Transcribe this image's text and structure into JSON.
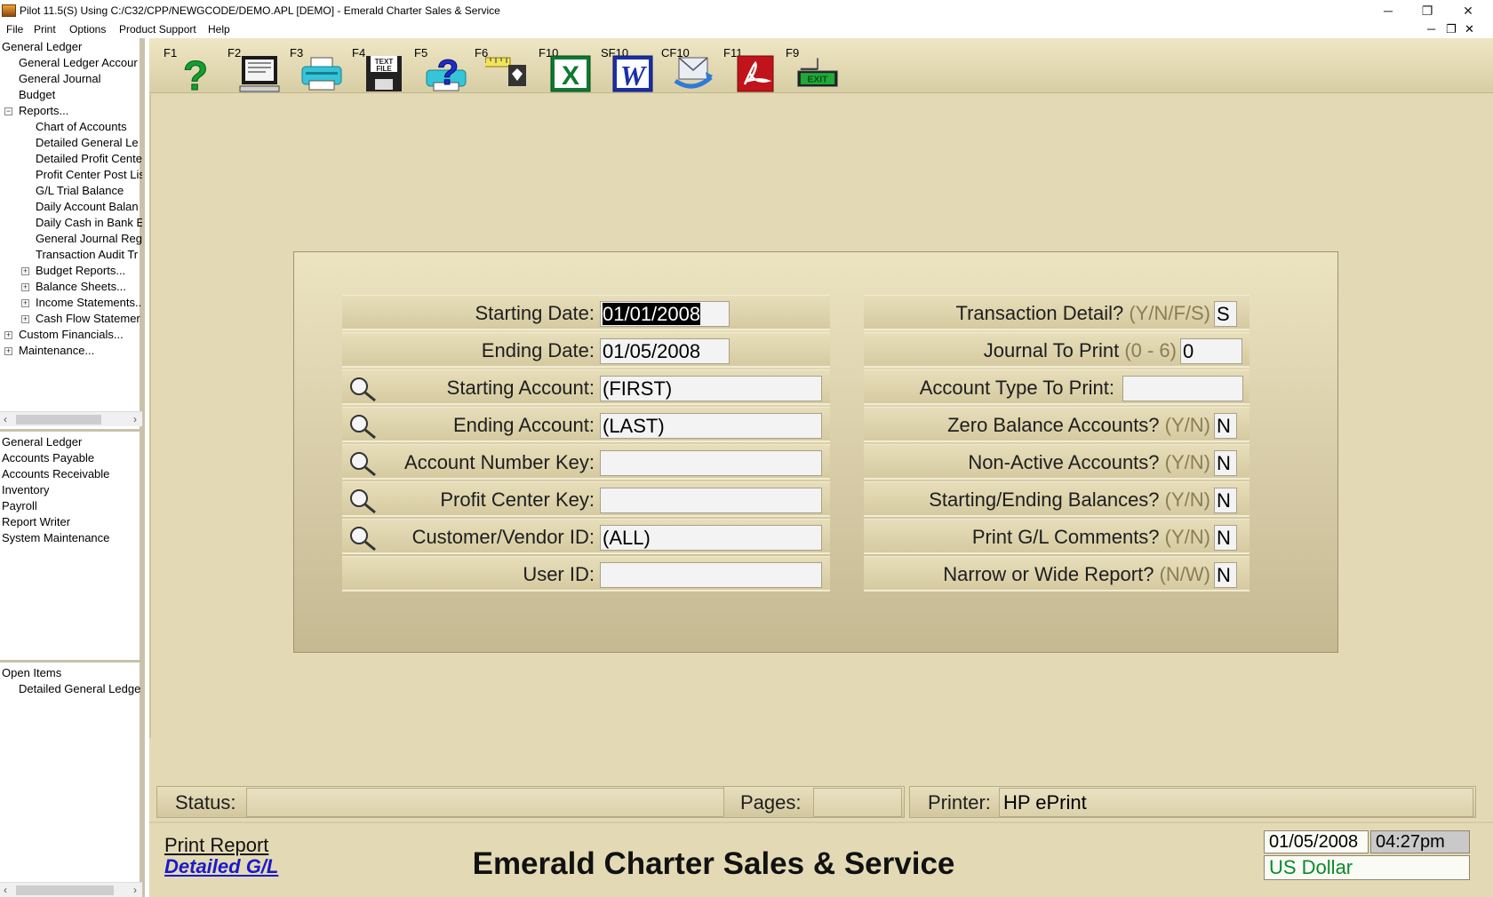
{
  "window": {
    "title": "Pilot 11.5(S) Using C:/C32/CPP/NEWGCODE/DEMO.APL [DEMO] - Emerald Charter Sales & Service",
    "minimize": "─",
    "restore": "❐",
    "close": "✕"
  },
  "menu": {
    "items": [
      "File",
      "Print",
      "Options",
      "Product Support",
      "Help"
    ],
    "mdi_min": "─",
    "mdi_restore": "❐",
    "mdi_close": "✕"
  },
  "sidebar": {
    "tree": [
      {
        "label": "General Ledger"
      },
      {
        "label": "General Ledger Accour"
      },
      {
        "label": "General Journal"
      },
      {
        "label": "Budget"
      },
      {
        "label": "Reports...",
        "expander": "−"
      },
      {
        "label": "Chart of Accounts"
      },
      {
        "label": "Detailed General Le"
      },
      {
        "label": "Detailed Profit Cente"
      },
      {
        "label": "Profit Center Post Lis"
      },
      {
        "label": "G/L Trial Balance"
      },
      {
        "label": "Daily Account Balan"
      },
      {
        "label": "Daily Cash in Bank E"
      },
      {
        "label": "General Journal Reg"
      },
      {
        "label": "Transaction Audit Tr"
      },
      {
        "label": "Budget Reports...",
        "expander": "+"
      },
      {
        "label": "Balance Sheets...",
        "expander": "+"
      },
      {
        "label": "Income Statements...",
        "expander": "+"
      },
      {
        "label": "Cash Flow Statemer",
        "expander": "+"
      },
      {
        "label": "Custom Financials...",
        "expander": "+"
      },
      {
        "label": "Maintenance...",
        "expander": "+"
      }
    ],
    "modules": [
      "General Ledger",
      "Accounts Payable",
      "Accounts Receivable",
      "Inventory",
      "Payroll",
      "Report Writer",
      "System Maintenance"
    ],
    "open_items_title": "Open Items",
    "open_items": [
      "Detailed General Ledge"
    ]
  },
  "toolbar": {
    "buttons": [
      {
        "key": "F1",
        "icon": "help-icon"
      },
      {
        "key": "F2",
        "icon": "screen-preview-icon"
      },
      {
        "key": "F3",
        "icon": "printer-icon"
      },
      {
        "key": "F4",
        "icon": "text-file-icon",
        "text": "TEXT FILE"
      },
      {
        "key": "F5",
        "icon": "printer-help-icon"
      },
      {
        "key": "F6",
        "icon": "ruler-icon"
      },
      {
        "key": "F10",
        "icon": "excel-icon",
        "text": "X"
      },
      {
        "key": "SF10",
        "icon": "word-icon",
        "text": "W"
      },
      {
        "key": "CF10",
        "icon": "email-icon"
      },
      {
        "key": "F11",
        "icon": "pdf-icon"
      },
      {
        "key": "F9",
        "icon": "exit-icon",
        "text": "EXIT"
      }
    ]
  },
  "form": {
    "left": [
      {
        "label": "Starting Date:",
        "value": "01/01/2008",
        "selected": true,
        "search": false
      },
      {
        "label": "Ending Date:",
        "value": "01/05/2008",
        "search": false
      },
      {
        "label": "Starting Account:",
        "value": "(FIRST)",
        "search": true
      },
      {
        "label": "Ending Account:",
        "value": "(LAST)",
        "search": true
      },
      {
        "label": "Account Number Key:",
        "value": "",
        "search": true
      },
      {
        "label": "Profit Center Key:",
        "value": "",
        "search": true
      },
      {
        "label": "Customer/Vendor ID:",
        "value": "(ALL)",
        "search": true
      },
      {
        "label": "User ID:",
        "value": "",
        "search": false
      }
    ],
    "right": [
      {
        "label": "Transaction Detail?",
        "hint": "(Y/N/F/S)",
        "value": "S"
      },
      {
        "label": "Journal To Print",
        "hint": "(0 - 6)",
        "value": "0"
      },
      {
        "label": "Account Type To Print:",
        "hint": "",
        "value": ""
      },
      {
        "label": "Zero Balance Accounts?",
        "hint": "(Y/N)",
        "value": "N"
      },
      {
        "label": "Non-Active Accounts?",
        "hint": "(Y/N)",
        "value": "N"
      },
      {
        "label": "Starting/Ending Balances?",
        "hint": "(Y/N)",
        "value": "N"
      },
      {
        "label": "Print G/L Comments?",
        "hint": "(Y/N)",
        "value": "N"
      },
      {
        "label": "Narrow or Wide Report?",
        "hint": "(N/W)",
        "value": "N"
      }
    ]
  },
  "status": {
    "status_label": "Status:",
    "status_value": "",
    "pages_label": "Pages:",
    "pages_value": "",
    "printer_label": "Printer:",
    "printer_value": "HP ePrint"
  },
  "footer": {
    "print_report": "Print Report",
    "report_name": "Detailed G/L",
    "company": "Emerald Charter Sales & Service",
    "date": "01/05/2008",
    "time": "04:27pm",
    "currency": "US Dollar"
  },
  "colors": {
    "background": "#e3dab5",
    "accent_green": "#0a8a2a",
    "link_blue": "#1a1acc"
  }
}
